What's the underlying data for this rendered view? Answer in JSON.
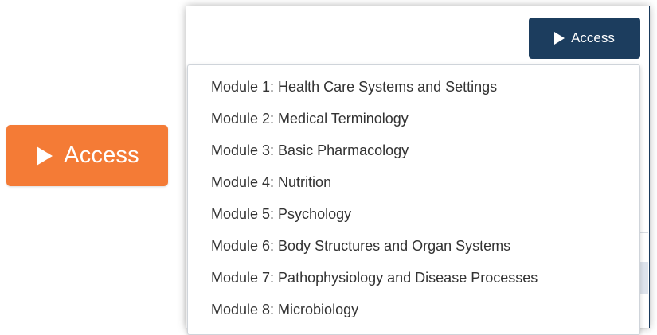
{
  "colors": {
    "orange": "#f47b36",
    "navy": "#1c3d5e"
  },
  "icons": {
    "play": "play-triangle-icon"
  },
  "left_button": {
    "label": "Access"
  },
  "panel": {
    "access_button": {
      "label": "Access"
    },
    "dropdown": {
      "items": [
        {
          "label": "Module 1: Health Care Systems and Settings"
        },
        {
          "label": "Module 2: Medical Terminology"
        },
        {
          "label": "Module 3: Basic Pharmacology"
        },
        {
          "label": "Module 4: Nutrition"
        },
        {
          "label": "Module 5: Psychology"
        },
        {
          "label": "Module 6: Body Structures and Organ Systems"
        },
        {
          "label": "Module 7: Pathophysiology and Disease Processes"
        },
        {
          "label": "Module 8: Microbiology"
        }
      ]
    }
  }
}
